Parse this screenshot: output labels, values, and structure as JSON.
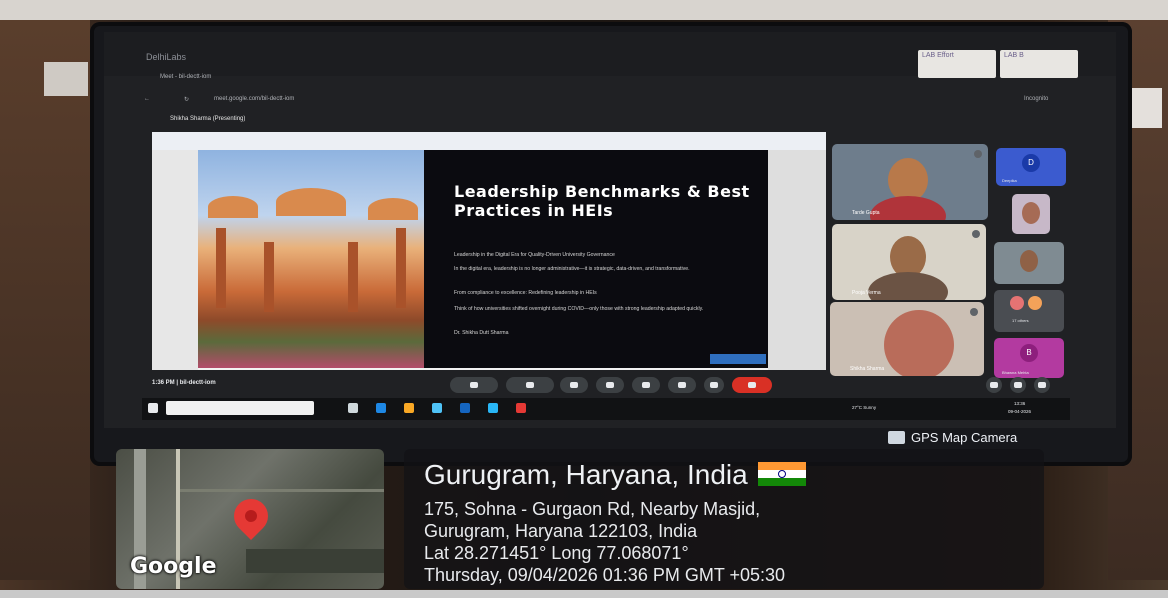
{
  "window": {
    "title": "DelhiLabs"
  },
  "browser": {
    "tab_title": "Meet - bil-dectt-iom",
    "url": "meet.google.com/bil-dectt-iom",
    "profile": "Incognito"
  },
  "stickers": {
    "note1": "LAB Effort",
    "note2": "LAB B"
  },
  "presenter": {
    "label": "Shikha Sharma (Presenting)"
  },
  "slide": {
    "title": "Leadership Benchmarks & Best Practices in HEIs",
    "subtitle": "Leadership in the Digital Era for Quality-Driven University Governance",
    "p1": "In the digital era, leadership is no longer administrative—it is strategic, data-driven, and transformative.",
    "p2": "From compliance to excellence: Redefining leadership in HEIs",
    "p3": "Think of how universities shifted overnight during COVID—only those with strong leadership adapted quickly.",
    "author": "Dr. Shikha Dutt Sharma"
  },
  "participants": {
    "p1": "Tarde Gupta",
    "p2": "Pooja Verma",
    "p3": "Shikha Sharma",
    "side1_initial": "D",
    "side1_name": "Deepika",
    "side_others": "17 others",
    "side_last_initial": "B",
    "side_last_name": "Bhawna Mehta"
  },
  "meeting": {
    "time_code": "1:36 PM | bil-dectt-iom"
  },
  "taskbar": {
    "weather": "27°C Sunny",
    "clock_time": "13:36",
    "clock_date": "09-04-2026"
  },
  "gps": {
    "app_label": "GPS Map Camera",
    "city": "Gurugram, Haryana, India",
    "address1": "175, Sohna - Gurgaon Rd, Nearby Masjid,",
    "address2": "Gurugram, Haryana 122103, India",
    "coords": "Lat 28.271451° Long 77.068071°",
    "datetime": "Thursday, 09/04/2026 01:36 PM GMT +05:30",
    "map_brand": "Google"
  },
  "colors": {
    "end_call": "#d93025",
    "meet_bg": "#202124",
    "accent_blue": "#2f6fbf"
  }
}
